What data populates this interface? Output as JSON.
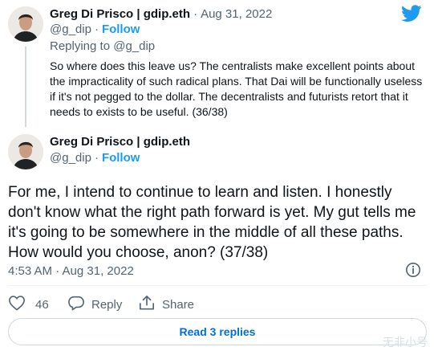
{
  "tweet1": {
    "display_name": "Greg Di Prisco | gdip.eth",
    "date": "Aug 31, 2022",
    "handle": "@g_dip",
    "follow_label": "Follow",
    "replying_to": "Replying to @g_dip",
    "text": "So where does this leave us? The centralists make excellent points about the impracticality of such radical plans. That Dai will be functionally useless if it's not pegged to the dollar. The decentralists and futurists retort that it needs to exists to be useful. (36/38)"
  },
  "tweet2": {
    "display_name": "Greg Di Prisco | gdip.eth",
    "handle": "@g_dip",
    "follow_label": "Follow",
    "text": "For me, I intend to continue to learn and listen. I honestly don't know what the right path forward is yet. My gut tells me it's going to be somewhere in the middle of all these paths. How would you choose, anon? (37/38)",
    "timestamp": "4:53 AM · Aug 31, 2022"
  },
  "actions": {
    "like_count": "46",
    "reply_label": "Reply",
    "share_label": "Share"
  },
  "read_replies_label": "Read 3 replies",
  "separator": "·",
  "watermark": "无非小号",
  "colors": {
    "accent": "#1d9bf0",
    "text": "#0f1419",
    "muted": "#536471"
  },
  "icons": [
    "twitter-bird-icon",
    "info-icon",
    "heart-icon",
    "reply-icon",
    "share-icon"
  ]
}
